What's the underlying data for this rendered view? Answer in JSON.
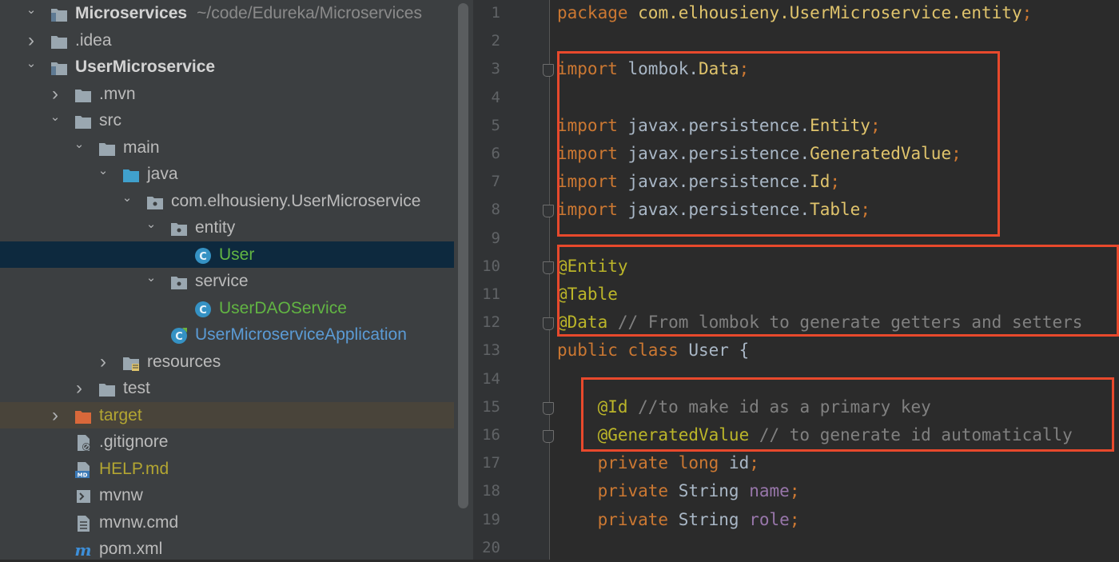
{
  "project_tree": {
    "root": {
      "name": "Microservices",
      "path": "~/code/Edureka/Microservices"
    },
    "items": [
      {
        "label": "Microservices",
        "path": "~/code/Edureka/Microservices",
        "icon": "module-folder-icon",
        "arrow": "expanded"
      },
      {
        "label": ".idea",
        "icon": "folder-icon",
        "arrow": "collapsed"
      },
      {
        "label": "UserMicroservice",
        "icon": "module-folder-icon",
        "arrow": "expanded"
      },
      {
        "label": ".mvn",
        "icon": "folder-icon",
        "arrow": "collapsed"
      },
      {
        "label": "src",
        "icon": "folder-icon",
        "arrow": "expanded"
      },
      {
        "label": "main",
        "icon": "folder-icon",
        "arrow": "expanded"
      },
      {
        "label": "java",
        "icon": "source-folder-icon",
        "arrow": "expanded"
      },
      {
        "label": "com.elhousieny.UserMicroservice",
        "icon": "package-icon",
        "arrow": "expanded"
      },
      {
        "label": "entity",
        "icon": "package-icon",
        "arrow": "expanded"
      },
      {
        "label": "User",
        "icon": "java-class-icon",
        "arrow": "none",
        "selected": true
      },
      {
        "label": "service",
        "icon": "package-icon",
        "arrow": "expanded"
      },
      {
        "label": "UserDAOService",
        "icon": "java-class-icon",
        "arrow": "none"
      },
      {
        "label": "UserMicroserviceApplication",
        "icon": "spring-boot-class-icon",
        "arrow": "none"
      },
      {
        "label": "resources",
        "icon": "resources-folder-icon",
        "arrow": "collapsed"
      },
      {
        "label": "test",
        "icon": "folder-icon",
        "arrow": "collapsed"
      },
      {
        "label": "target",
        "icon": "excluded-folder-icon",
        "arrow": "collapsed"
      },
      {
        "label": ".gitignore",
        "icon": "ignore-file-icon",
        "arrow": "none"
      },
      {
        "label": "HELP.md",
        "icon": "markdown-file-icon",
        "arrow": "none"
      },
      {
        "label": "mvnw",
        "icon": "script-file-icon",
        "arrow": "none"
      },
      {
        "label": "mvnw.cmd",
        "icon": "text-file-icon",
        "arrow": "none"
      },
      {
        "label": "pom.xml",
        "icon": "maven-icon",
        "arrow": "none"
      }
    ]
  },
  "editor": {
    "line_numbers": [
      "1",
      "2",
      "3",
      "4",
      "5",
      "6",
      "7",
      "8",
      "9",
      "10",
      "11",
      "12",
      "13",
      "14",
      "15",
      "16",
      "17",
      "18",
      "19",
      "20"
    ],
    "lines": [
      [
        {
          "t": "package ",
          "c": "kw"
        },
        {
          "t": "com.elhousieny.UserMicroservice.entity",
          "c": "cls"
        },
        {
          "t": ";",
          "c": "kw"
        }
      ],
      [],
      [
        {
          "t": "import ",
          "c": "kw"
        },
        {
          "t": "lombok.",
          "c": "txt"
        },
        {
          "t": "Data",
          "c": "cls"
        },
        {
          "t": ";",
          "c": "kw"
        }
      ],
      [],
      [
        {
          "t": "import ",
          "c": "kw"
        },
        {
          "t": "javax.persistence.",
          "c": "txt"
        },
        {
          "t": "Entity",
          "c": "cls"
        },
        {
          "t": ";",
          "c": "kw"
        }
      ],
      [
        {
          "t": "import ",
          "c": "kw"
        },
        {
          "t": "javax.persistence.",
          "c": "txt"
        },
        {
          "t": "GeneratedValue",
          "c": "cls"
        },
        {
          "t": ";",
          "c": "kw"
        }
      ],
      [
        {
          "t": "import ",
          "c": "kw"
        },
        {
          "t": "javax.persistence.",
          "c": "txt"
        },
        {
          "t": "Id",
          "c": "cls"
        },
        {
          "t": ";",
          "c": "kw"
        }
      ],
      [
        {
          "t": "import ",
          "c": "kw"
        },
        {
          "t": "javax.persistence.",
          "c": "txt"
        },
        {
          "t": "Table",
          "c": "cls"
        },
        {
          "t": ";",
          "c": "kw"
        }
      ],
      [],
      [
        {
          "t": "@Entity",
          "c": "ann"
        }
      ],
      [
        {
          "t": "@Table",
          "c": "ann"
        }
      ],
      [
        {
          "t": "@Data",
          "c": "ann"
        },
        {
          "t": " // From lombok to generate getters and setters",
          "c": "cmt"
        }
      ],
      [
        {
          "t": "public class ",
          "c": "kw"
        },
        {
          "t": "User ",
          "c": "txt"
        },
        {
          "t": "{",
          "c": "txt"
        }
      ],
      [],
      [
        {
          "t": "    @Id",
          "c": "ann"
        },
        {
          "t": " //to make id as a primary key",
          "c": "cmt"
        }
      ],
      [
        {
          "t": "    @GeneratedValue",
          "c": "ann"
        },
        {
          "t": " // to generate id automatically",
          "c": "cmt"
        }
      ],
      [
        {
          "t": "    private long ",
          "c": "kw"
        },
        {
          "t": "id",
          "c": "txt"
        },
        {
          "t": ";",
          "c": "kw"
        }
      ],
      [
        {
          "t": "    private ",
          "c": "kw"
        },
        {
          "t": "String ",
          "c": "txt"
        },
        {
          "t": "name",
          "c": "fld"
        },
        {
          "t": ";",
          "c": "kw"
        }
      ],
      [
        {
          "t": "    private ",
          "c": "kw"
        },
        {
          "t": "String ",
          "c": "txt"
        },
        {
          "t": "role",
          "c": "fld"
        },
        {
          "t": ";",
          "c": "kw"
        }
      ],
      []
    ]
  },
  "colors": {
    "highlight_box": "#e8492c",
    "selection": "#0d293e",
    "keyword": "#cc7832",
    "annotation": "#bbb529"
  }
}
